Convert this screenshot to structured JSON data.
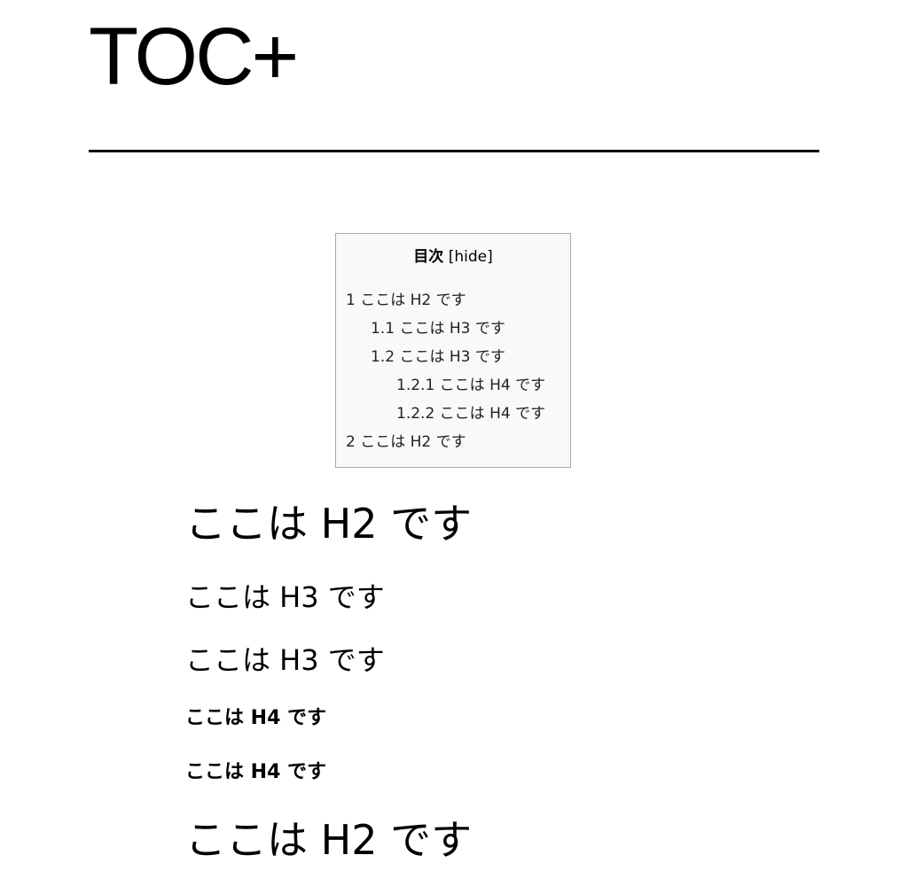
{
  "site": {
    "title": "TOC+"
  },
  "toc": {
    "title": "目次",
    "toggle_label": "[hide]",
    "items": [
      {
        "number": "1",
        "text": "ここは H2 です",
        "level": 1
      },
      {
        "number": "1.1",
        "text": "ここは H3 です",
        "level": 2
      },
      {
        "number": "1.2",
        "text": "ここは H3 です",
        "level": 2
      },
      {
        "number": "1.2.1",
        "text": "ここは H4 です",
        "level": 3
      },
      {
        "number": "1.2.2",
        "text": "ここは H4 です",
        "level": 3
      },
      {
        "number": "2",
        "text": "ここは H2 です",
        "level": 1
      }
    ]
  },
  "headings": [
    {
      "tag": "h2",
      "text": "ここは H2 です"
    },
    {
      "tag": "h3",
      "text": "ここは H3 です"
    },
    {
      "tag": "h3",
      "text": "ここは H3 です"
    },
    {
      "tag": "h4",
      "text": "ここは H4 です"
    },
    {
      "tag": "h4",
      "text": "ここは H4 です"
    },
    {
      "tag": "h2",
      "text": "ここは H2 です"
    }
  ]
}
